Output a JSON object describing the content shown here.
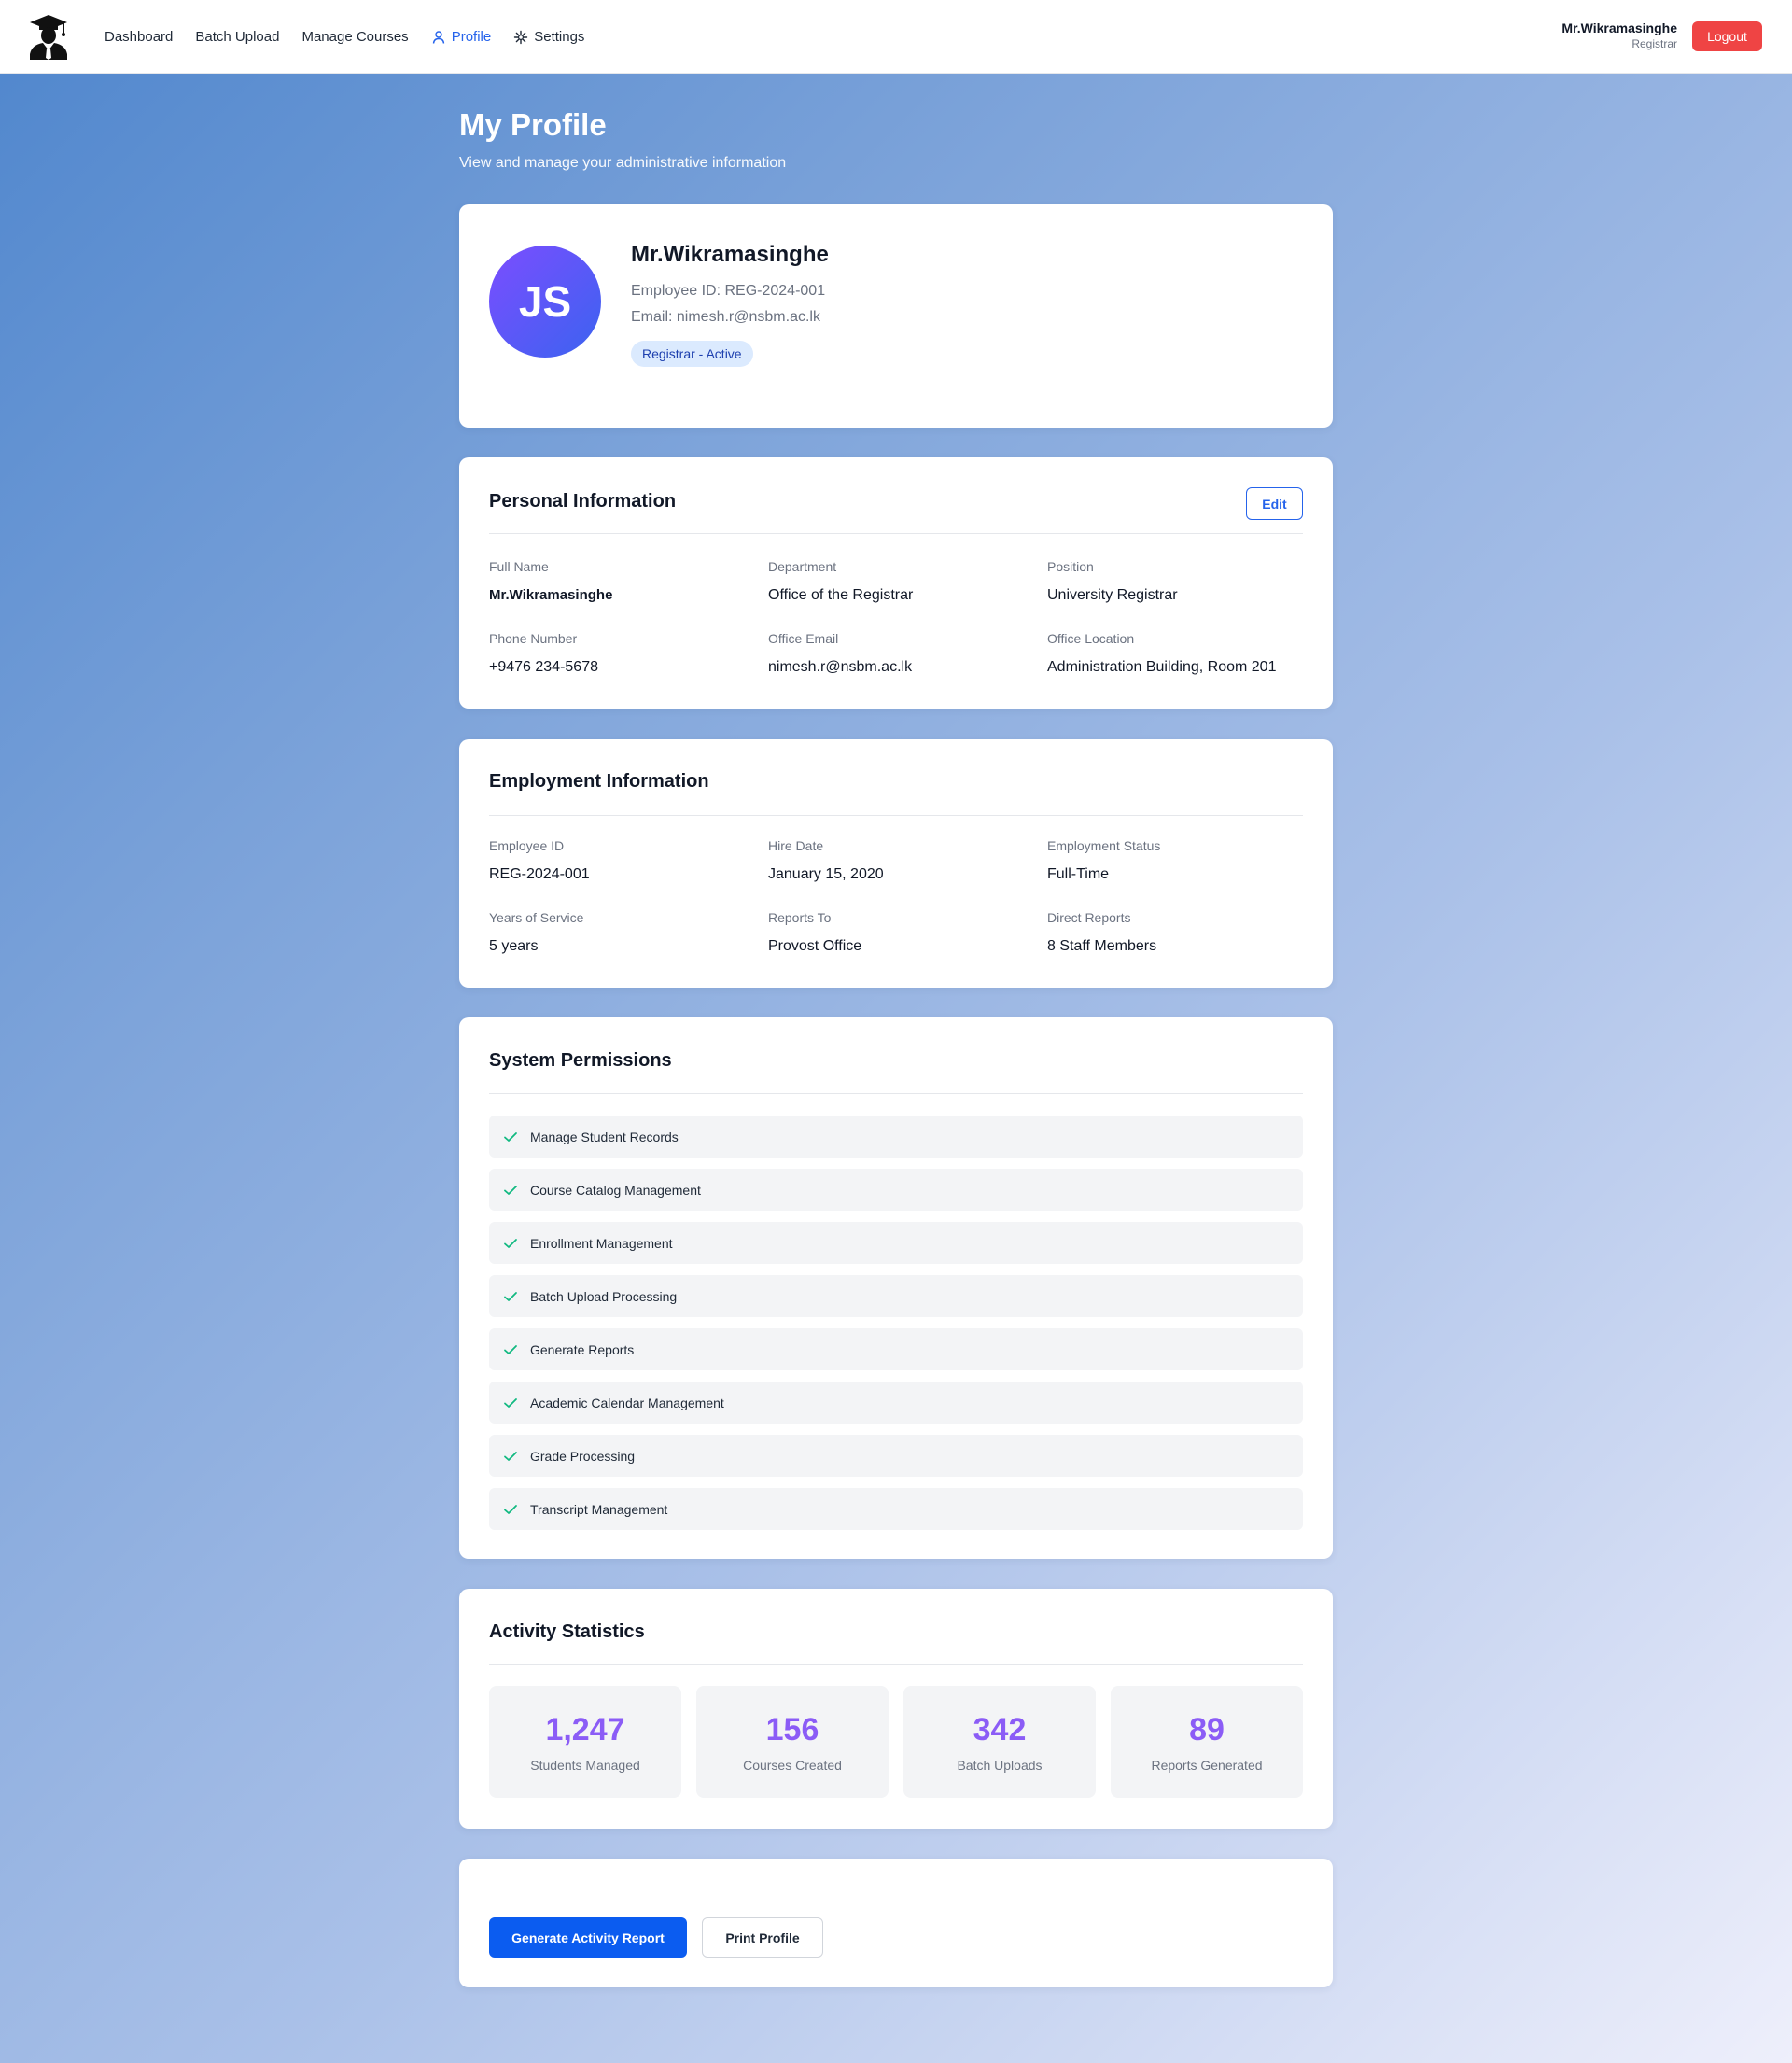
{
  "nav": {
    "items": [
      {
        "label": "Dashboard",
        "icon": "",
        "active": false
      },
      {
        "label": "Batch Upload",
        "icon": "",
        "active": false
      },
      {
        "label": "Manage Courses",
        "icon": "",
        "active": false
      },
      {
        "label": "Profile",
        "icon": "user-icon",
        "active": true
      },
      {
        "label": "Settings",
        "icon": "settings-icon",
        "active": false
      }
    ],
    "user_name": "Mr.Wikramasinghe",
    "user_role": "Registrar",
    "logout_label": "Logout"
  },
  "header": {
    "title": "My Profile",
    "subtitle": "View and manage your administrative information"
  },
  "profile": {
    "initials": "JS",
    "name": "Mr.Wikramasinghe",
    "employee_id_line": "Employee ID: REG-2024-001",
    "email_line": "Email: nimesh.r@nsbm.ac.lk",
    "badge": "Registrar - Active"
  },
  "personal": {
    "title": "Personal Information",
    "edit_label": "Edit",
    "fields": [
      {
        "label": "Full Name",
        "value": "Mr.Wikramasinghe"
      },
      {
        "label": "Department",
        "value": "Office of the Registrar"
      },
      {
        "label": "Position",
        "value": "University Registrar"
      },
      {
        "label": "Phone Number",
        "value": "+9476 234-5678"
      },
      {
        "label": "Office Email",
        "value": "nimesh.r@nsbm.ac.lk"
      },
      {
        "label": "Office Location",
        "value": "Administration Building, Room 201"
      }
    ]
  },
  "employment": {
    "title": "Employment Information",
    "fields": [
      {
        "label": "Employee ID",
        "value": "REG-2024-001"
      },
      {
        "label": "Hire Date",
        "value": "January 15, 2020"
      },
      {
        "label": "Employment Status",
        "value": "Full-Time"
      },
      {
        "label": "Years of Service",
        "value": "5 years"
      },
      {
        "label": "Reports To",
        "value": "Provost Office"
      },
      {
        "label": "Direct Reports",
        "value": "8 Staff Members"
      }
    ]
  },
  "permissions": {
    "title": "System Permissions",
    "items": [
      "Manage Student Records",
      "Course Catalog Management",
      "Enrollment Management",
      "Batch Upload Processing",
      "Generate Reports",
      "Academic Calendar Management",
      "Grade Processing",
      "Transcript Management"
    ]
  },
  "stats": {
    "title": "Activity Statistics",
    "items": [
      {
        "value": "1,247",
        "label": "Students Managed"
      },
      {
        "value": "156",
        "label": "Courses Created"
      },
      {
        "value": "342",
        "label": "Batch Uploads"
      },
      {
        "value": "89",
        "label": "Reports Generated"
      }
    ]
  },
  "actions": {
    "primary_label": "Generate Activity Report",
    "secondary_label": "Print Profile"
  },
  "colors": {
    "accent": "#2563eb",
    "logout": "#ef4444",
    "stat_value": "#8b5cf6",
    "check": "#10b981"
  }
}
